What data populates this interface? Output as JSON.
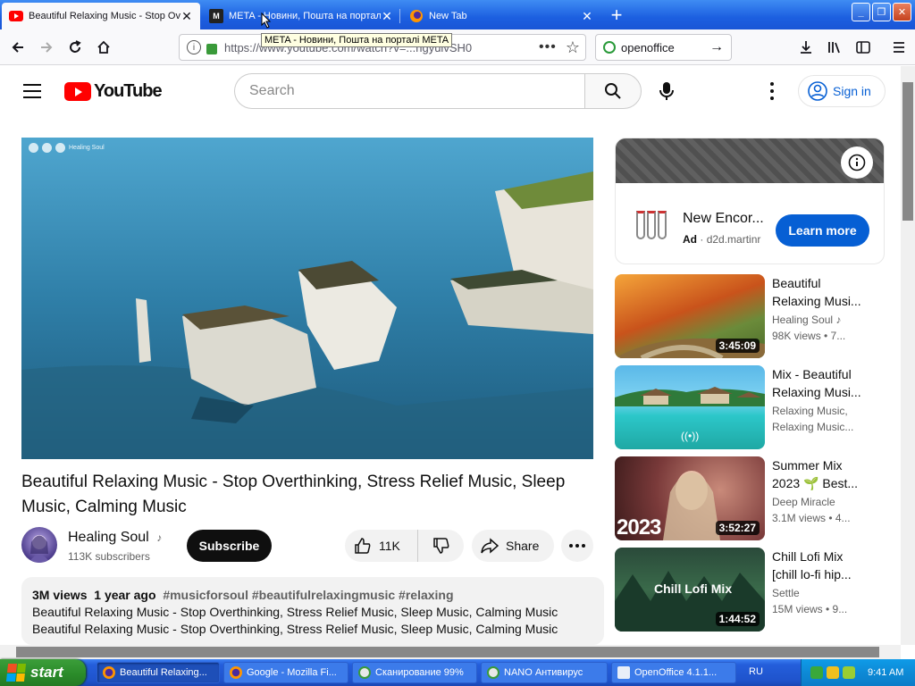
{
  "browser": {
    "tabs": [
      {
        "title": "Beautiful Relaxing Music - Stop Ov",
        "active": true
      },
      {
        "title": "META - Новини, Пошта на порталі",
        "active": false
      },
      {
        "title": "New Tab",
        "active": false
      }
    ],
    "url": "https://www.youtube.com/watch?v=...ngyuivSH0",
    "search_value": "openoffice",
    "tooltip": "META - Новини, Пошта на порталі META"
  },
  "youtube": {
    "logo_text": "YouTube",
    "search_placeholder": "Search",
    "sign_in": "Sign in"
  },
  "video": {
    "watermark": "Healing Soul",
    "title": "Beautiful Relaxing Music - Stop Overthinking, Stress Relief Music, Sleep Music, Calming Music",
    "channel": "Healing Soul",
    "music_note": "♪",
    "subscribers": "113K subscribers",
    "subscribe_label": "Subscribe",
    "likes": "11K",
    "share_label": "Share",
    "description": {
      "views": "3M views",
      "age": "1 year ago",
      "tags": "#musicforsoul #beautifulrelaxingmusic #relaxing",
      "lines": [
        "Beautiful Relaxing Music - Stop Overthinking, Stress Relief Music, Sleep Music, Calming Music",
        "Beautiful Relaxing Music - Stop Overthinking, Stress Relief Music, Sleep Music, Calming Music"
      ]
    }
  },
  "ad": {
    "title": "New Encor...",
    "badge": "Ad",
    "separator": "·",
    "domain": "d2d.martinr",
    "cta": "Learn more"
  },
  "recommendations": [
    {
      "title": "Beautiful Relaxing Musi...",
      "channel": "Healing Soul ♪",
      "views": "98K views • 7...",
      "duration": "3:45:09"
    },
    {
      "title": "Mix - Beautiful Relaxing Musi...",
      "channel": "Relaxing Music,",
      "views": "Relaxing Music...",
      "duration": ""
    },
    {
      "title": "Summer Mix 2023 🌱 Best...",
      "channel": "Deep Miracle",
      "views": "3.1M views • 4...",
      "duration": "3:52:27",
      "overlay": "2023"
    },
    {
      "title": "Chill Lofi Mix [chill lo-fi hip...",
      "channel": "Settle",
      "views": "15M views • 9...",
      "duration": "1:44:52",
      "overlay": "Chill Lofi Mix"
    }
  ],
  "taskbar": {
    "start_label": "start",
    "items": [
      {
        "label": "Beautiful Relaxing...",
        "active": true
      },
      {
        "label": "Google - Mozilla Fi...",
        "active": false
      },
      {
        "label": "Сканирование 99%",
        "active": false
      },
      {
        "label": "NANO Антивирус",
        "active": false
      },
      {
        "label": "OpenOffice 4.1.1...",
        "active": false
      }
    ],
    "language": "RU",
    "clock": "9:41 AM"
  },
  "colors": {
    "youtube_red": "#ff0000",
    "link_blue": "#065fd4",
    "xp_blue": "#245edb",
    "xp_green": "#2a8a29"
  }
}
